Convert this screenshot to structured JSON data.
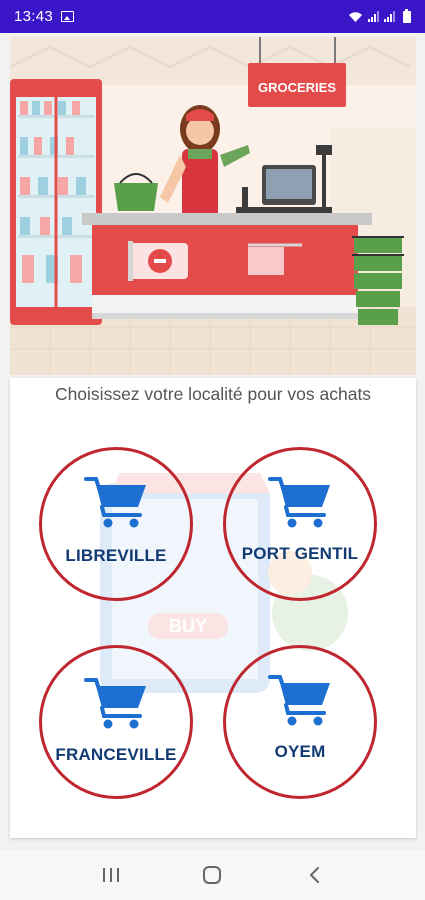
{
  "status_bar": {
    "time": "13:43",
    "icons": [
      "image-icon",
      "wifi-icon",
      "signal-icon",
      "signal-icon",
      "battery-icon"
    ]
  },
  "hero": {
    "sign_text": "GROCERIES"
  },
  "main": {
    "prompt": "Choisissez votre localité pour vos achats",
    "watermark_text": "BUY",
    "cities": [
      {
        "label": "LIBREVILLE",
        "icon": "shopping-cart-icon"
      },
      {
        "label": "PORT GENTIL",
        "icon": "shopping-cart-icon"
      },
      {
        "label": "FRANCEVILLE",
        "icon": "shopping-cart-icon"
      },
      {
        "label": "OYEM",
        "icon": "shopping-cart-icon"
      }
    ]
  },
  "colors": {
    "status_bar": "#3b16c9",
    "circle_border": "#c0262e",
    "city_label": "#123b73",
    "cart_blue": "#1d6fd1"
  },
  "nav": {
    "buttons": [
      "recents-icon",
      "home-icon",
      "back-icon"
    ]
  }
}
